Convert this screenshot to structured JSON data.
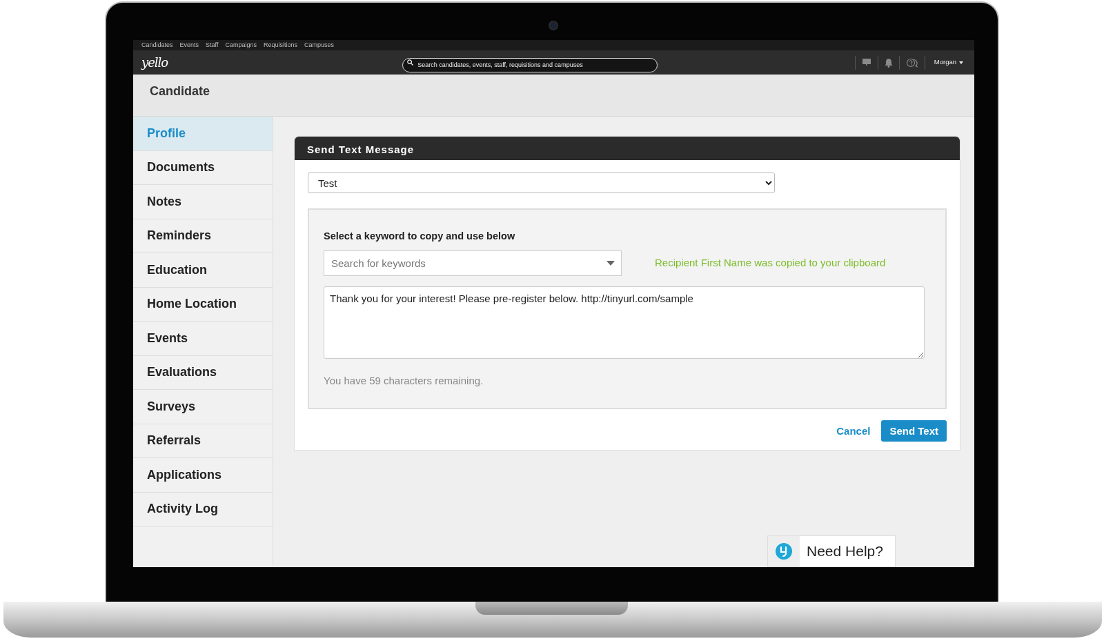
{
  "top_links": [
    {
      "label": "Candidates"
    },
    {
      "label": "Events"
    },
    {
      "label": "Staff"
    },
    {
      "label": "Campaigns"
    },
    {
      "label": "Requisitions"
    },
    {
      "label": "Campuses"
    }
  ],
  "navbar": {
    "logo": "yello",
    "search": {
      "placeholder": "Search candidates, events, staff, requisitions and campuses"
    },
    "user": "Morgan"
  },
  "page_title": "Candidate",
  "sidebar": {
    "items": [
      {
        "label": "Profile",
        "selected": true
      },
      {
        "label": "Documents",
        "selected": false
      },
      {
        "label": "Notes",
        "selected": false
      },
      {
        "label": "Reminders",
        "selected": false
      },
      {
        "label": "Education",
        "selected": false
      },
      {
        "label": "Home Location",
        "selected": false
      },
      {
        "label": "Events",
        "selected": false
      },
      {
        "label": "Evaluations",
        "selected": false
      },
      {
        "label": "Surveys",
        "selected": false
      },
      {
        "label": "Referrals",
        "selected": false
      },
      {
        "label": "Applications",
        "selected": false
      },
      {
        "label": "Activity Log",
        "selected": false
      }
    ]
  },
  "dialog": {
    "title": "Send Text Message",
    "template": "Test",
    "keyword_label": "Select a keyword to copy and use below",
    "keyword_search": {
      "placeholder": "Search for keywords"
    },
    "copied_message": "Recipient First Name was copied to your clipboard",
    "message": "Thank you for your interest! Please pre-register below. http://tinyurl.com/sample",
    "remaining": "You have 59 characters remaining.",
    "buttons": [
      {
        "label": "Cancel",
        "kind": "link"
      },
      {
        "label": "Send Text",
        "kind": "primary"
      }
    ]
  },
  "help_widget": {
    "label": "Need Help?"
  }
}
